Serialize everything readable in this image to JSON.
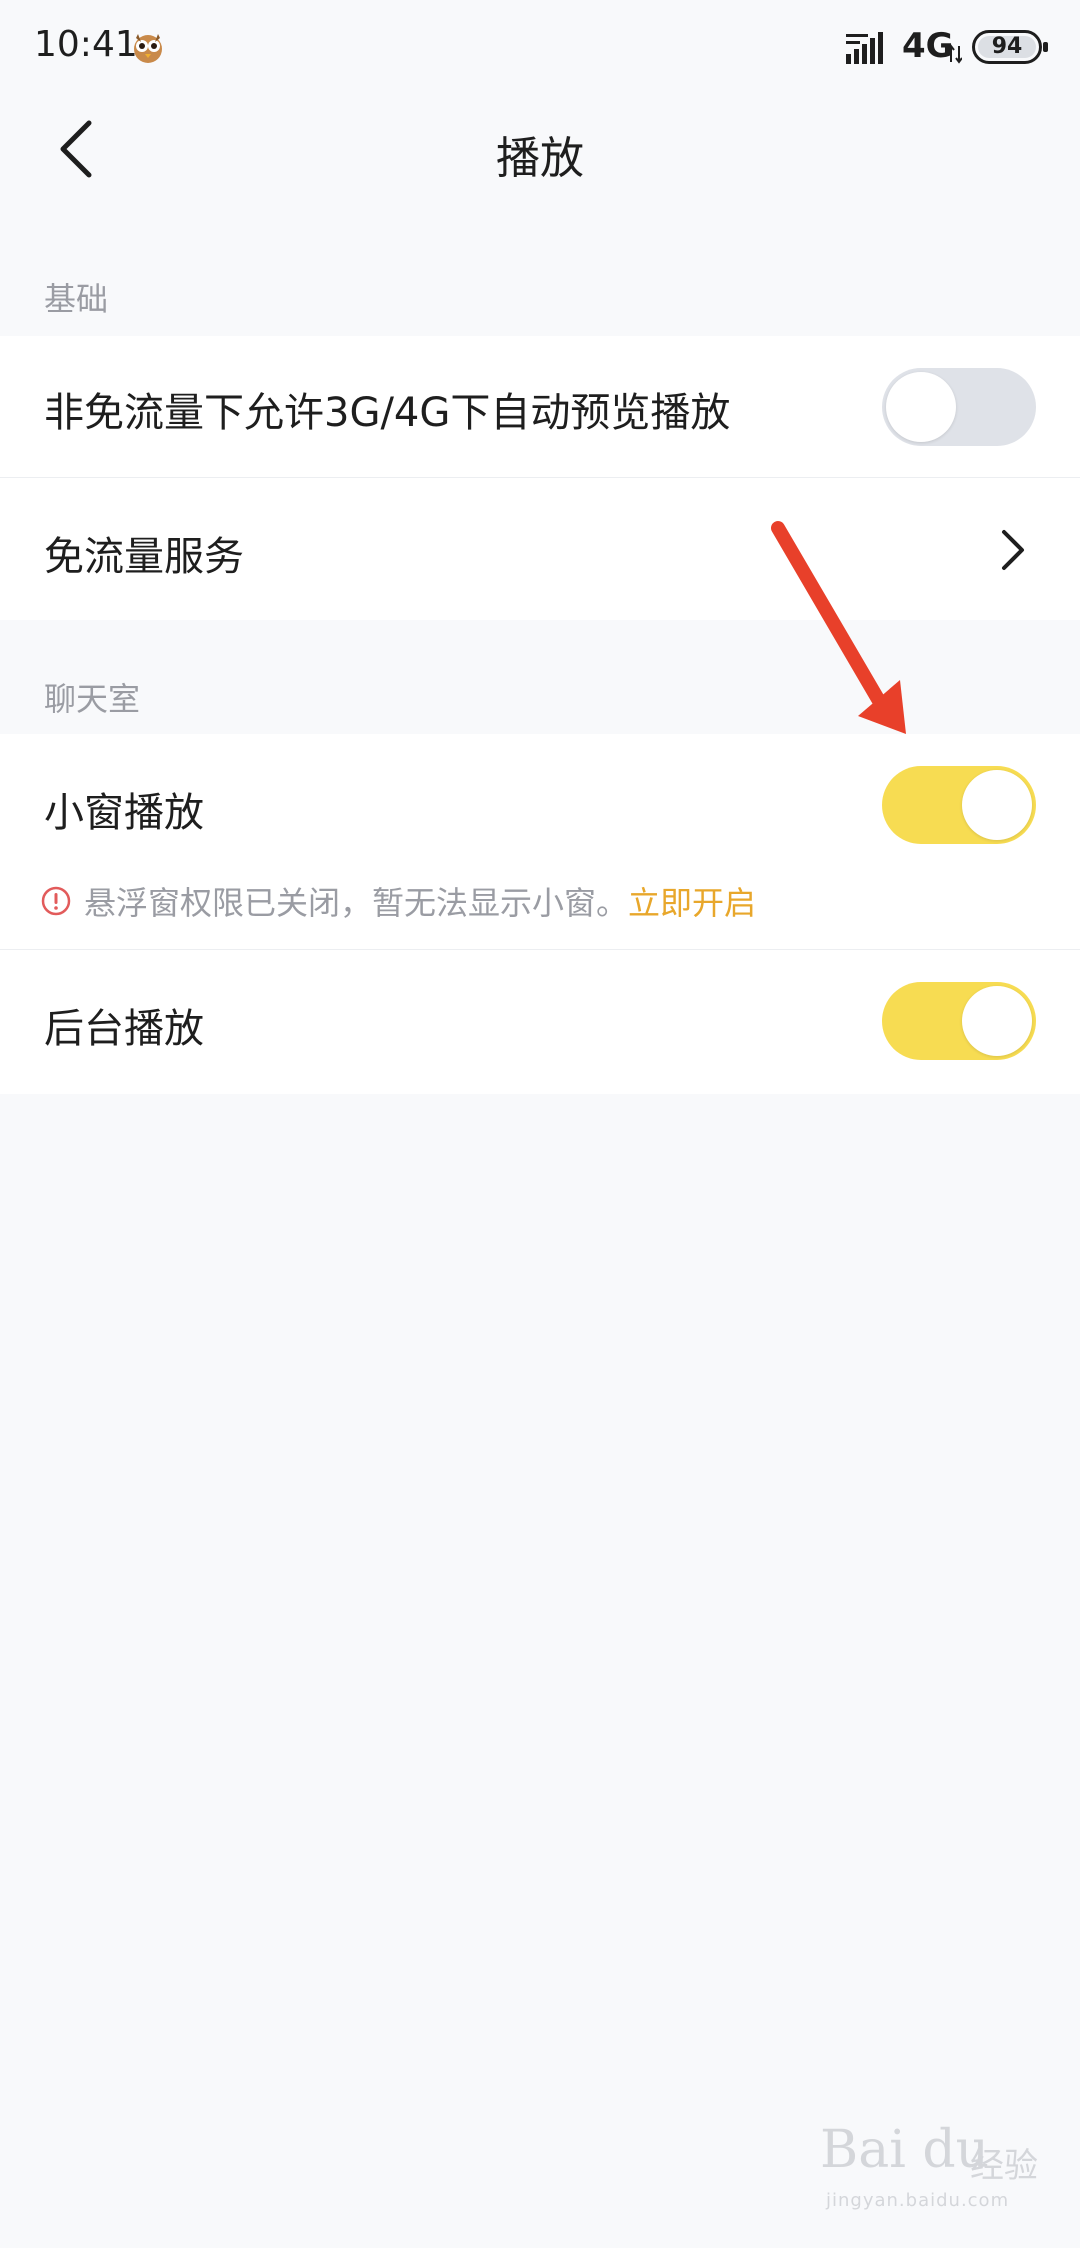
{
  "status_bar": {
    "time": "10:41",
    "network": "4G",
    "battery": "94",
    "emoji_icon": "owl-sticker-icon"
  },
  "nav": {
    "title": "播放",
    "back_icon": "chevron-left-icon"
  },
  "sections": [
    {
      "header": "基础",
      "rows": [
        {
          "label": "非免流量下允许3G/4G下自动预览播放",
          "control": "toggle",
          "on": false
        },
        {
          "label": "免流量服务",
          "control": "chevron"
        }
      ]
    },
    {
      "header": "聊天室",
      "rows": [
        {
          "label": "小窗播放",
          "control": "toggle",
          "on": true,
          "warning": "悬浮窗权限已关闭，暂无法显示小窗。",
          "warning_link": "立即开启"
        },
        {
          "label": "后台播放",
          "control": "toggle",
          "on": true
        }
      ]
    }
  ],
  "watermark": {
    "brand": "Bai du",
    "suffix": "经验",
    "url": "jingyan.baidu.com"
  },
  "colors": {
    "toggle_on": "#f7dc52",
    "toggle_off": "#dfe2e8",
    "link": "#e8a72b",
    "warning_icon": "#e25b5b",
    "annotation_arrow": "#e8402a",
    "background": "#f8f9fb"
  }
}
